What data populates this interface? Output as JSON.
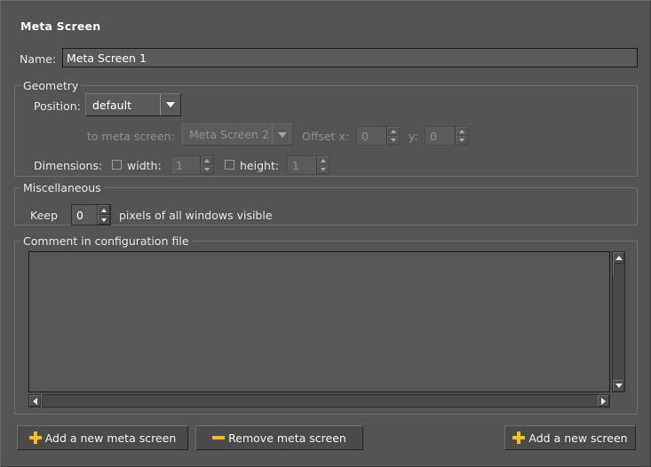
{
  "window": {
    "title": "Meta Screen"
  },
  "name_row": {
    "label": "Name:",
    "value": "Meta Screen 1",
    "placeholder": ""
  },
  "geometry": {
    "title": "Geometry",
    "position_label": "Position:",
    "position_value": "default",
    "position_options": [
      "default"
    ],
    "to_meta_screen_label": "to meta screen:",
    "to_meta_screen_value": "Meta Screen 2",
    "to_meta_screen_options": [
      "Meta Screen 2"
    ],
    "offset_x_label": "Offset x:",
    "offset_x_value": "0",
    "offset_y_label": "y:",
    "offset_y_value": "0",
    "dimensions_label": "Dimensions:",
    "width_label": "width:",
    "width_value": "1",
    "width_checked": false,
    "height_label": "height:",
    "height_value": "1",
    "height_checked": false
  },
  "miscellaneous": {
    "title": "Miscellaneous",
    "keep_label": "Keep",
    "keep_value": "0",
    "keep_suffix": "pixels of all windows visible"
  },
  "comment": {
    "title": "Comment in configuration file",
    "value": "",
    "placeholder": ""
  },
  "buttons": {
    "add_meta_screen": "Add a new meta screen",
    "remove_meta_screen": "Remove meta screen",
    "add_screen": "Add a new screen"
  },
  "icons": {
    "plus": "plus-icon",
    "minus": "minus-icon",
    "chevron_down": "chevron-down-icon",
    "scroll_up": "scroll-up-arrow-icon",
    "scroll_down": "scroll-down-arrow-icon",
    "scroll_left": "scroll-left-arrow-icon",
    "scroll_right": "scroll-right-arrow-icon"
  },
  "colors": {
    "background": "#545454",
    "accent_yellow": "#f5bf12",
    "text": "#e8e8e8",
    "disabled_text": "#8e8e8e",
    "field_background": "#5a5a5a",
    "field_border": "#1c1c1c"
  }
}
